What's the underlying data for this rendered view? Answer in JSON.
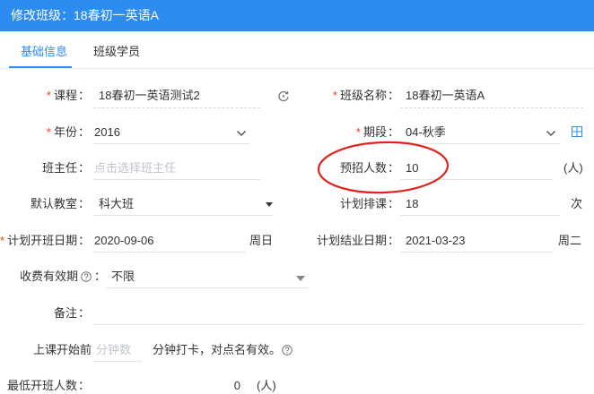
{
  "window": {
    "title": "修改班级：18春初一英语A"
  },
  "tabs": [
    {
      "label": "基础信息",
      "active": true
    },
    {
      "label": "班级学员",
      "active": false
    }
  ],
  "form": {
    "required_mark": "*",
    "colon": "：",
    "course": {
      "label": "课程",
      "value": "18春初一英语测试2"
    },
    "class_name": {
      "label": "班级名称",
      "value": "18春初一英语A"
    },
    "year": {
      "label": "年份",
      "value": "2016"
    },
    "term": {
      "label": "期段",
      "value": "04-秋季"
    },
    "head_teacher": {
      "label": "班主任",
      "placeholder": "点击选择班主任"
    },
    "planned_enrollment": {
      "label": "预招人数",
      "value": "10",
      "unit": "(人)"
    },
    "default_classroom": {
      "label": "默认教室",
      "value": "科大班"
    },
    "planned_sessions": {
      "label": "计划排课",
      "value": "18",
      "unit": "次"
    },
    "start_date": {
      "label": "计划开班日期",
      "value": "2020-09-06",
      "weekday": "周日"
    },
    "end_date": {
      "label": "计划结业日期",
      "value": "2021-03-23",
      "weekday": "周二"
    },
    "fee_validity": {
      "label": "收费有效期",
      "value": "不限"
    },
    "remarks": {
      "label": "备注",
      "value": ""
    },
    "class_start_before": {
      "label": "上课开始前",
      "placeholder": "分钟数",
      "suffix": "分钟打卡，对点名有效。"
    },
    "min_enrollment": {
      "label": "最低开班人数",
      "value": "0",
      "unit": "(人)"
    }
  },
  "colors": {
    "primary": "#2d8cf0",
    "required": "#ed3f14",
    "annotation": "#e0231d"
  },
  "icons": [
    "refresh-icon",
    "chevron-down-icon",
    "grid-add-icon",
    "help-icon",
    "caret-down-icon"
  ]
}
